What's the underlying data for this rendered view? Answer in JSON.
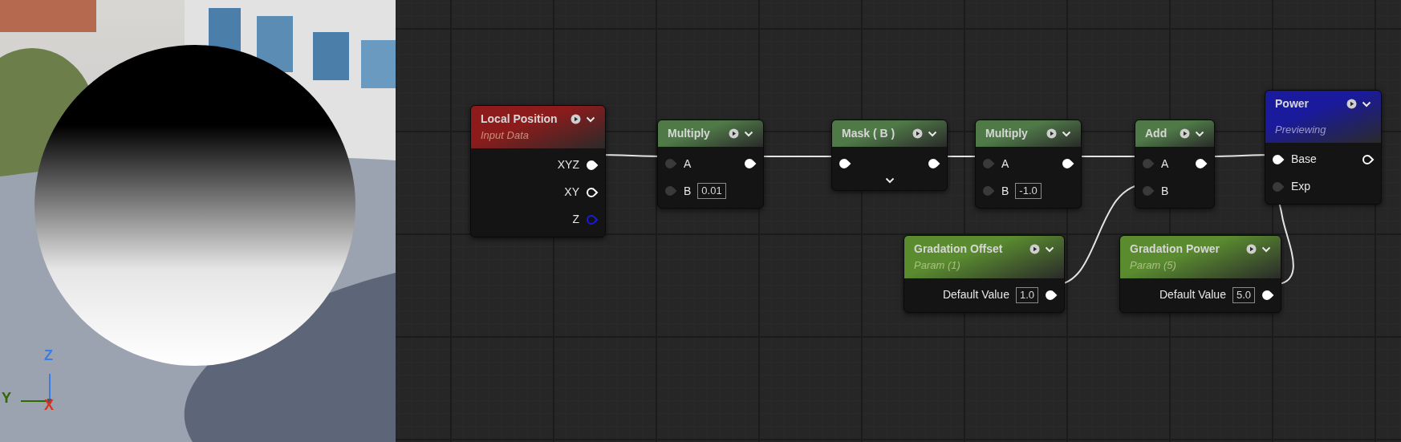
{
  "viewport": {
    "gizmo": [
      {
        "label": "Z",
        "color": "#3a7fe0"
      },
      {
        "label": "Y",
        "color": "#2f6a00"
      },
      {
        "label": "X",
        "color": "#d9321f"
      }
    ]
  },
  "nodes": [
    {
      "title": "Local Position",
      "subtitle": "Input Data",
      "color": "#8e1b1b",
      "rows": [
        {
          "label": "XYZ",
          "out": {
            "connected": true
          }
        },
        {
          "label": "XY",
          "out": {
            "connected": false
          }
        },
        {
          "label": "Z",
          "out": {
            "connected": false,
            "color": "#1b1be0"
          }
        }
      ]
    },
    {
      "title": "Multiply",
      "color": "#4f7a48",
      "rows": [
        {
          "label": "A",
          "in": {
            "connected": false
          },
          "out": {
            "connected": true
          }
        },
        {
          "label": "B",
          "value": "0.01",
          "in": {
            "connected": false
          }
        }
      ]
    },
    {
      "title": "Mask ( B )",
      "color": "#4f7a48",
      "advanced": true,
      "rows": [
        {
          "in": {
            "connected": true
          },
          "out": {
            "connected": true
          }
        }
      ]
    },
    {
      "title": "Multiply",
      "color": "#4f7a48",
      "rows": [
        {
          "label": "A",
          "in": {
            "connected": false
          },
          "out": {
            "connected": true
          }
        },
        {
          "label": "B",
          "value": "-1.0",
          "in": {
            "connected": false
          }
        }
      ]
    },
    {
      "title": "Add",
      "color": "#4f7a48",
      "rows": [
        {
          "label": "A",
          "in": {
            "connected": false
          },
          "out": {
            "connected": true
          }
        },
        {
          "label": "B",
          "in": {
            "connected": false
          }
        }
      ]
    },
    {
      "title": "Power",
      "subtitle": "Previewing",
      "color": "#1a1a9c",
      "rows": [
        {
          "label": "Base",
          "in": {
            "connected": true
          },
          "out": {
            "connected": false
          }
        },
        {
          "label": "Exp",
          "in": {
            "connected": false
          }
        }
      ]
    },
    {
      "title": "Gradation Offset",
      "subtitle": "Param (1)",
      "color": "#5a8c2f",
      "rows": [
        {
          "label": "Default Value",
          "value": "1.0",
          "out": {
            "connected": true
          }
        }
      ]
    },
    {
      "title": "Gradation Power",
      "subtitle": "Param (5)",
      "color": "#5a8c2f",
      "rows": [
        {
          "label": "Default Value",
          "value": "5.0",
          "out": {
            "connected": true
          }
        }
      ]
    }
  ]
}
